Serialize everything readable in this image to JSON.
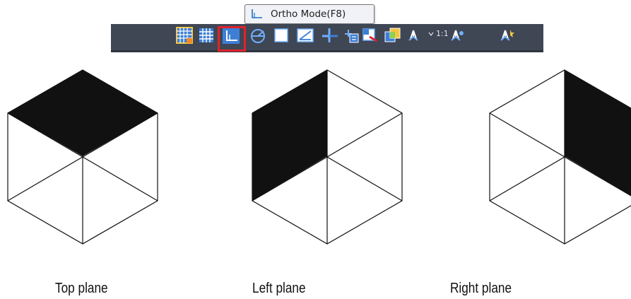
{
  "tooltip": {
    "text": "Ortho Mode(F8)",
    "icon": "ortho-icon"
  },
  "statusbar": {
    "scale_label": "1:1",
    "items": [
      "grid-display-icon",
      "snap-mode-icon",
      "ortho-mode-icon",
      "polar-tracking-icon",
      "isometric-draft-icon",
      "object-snap-tracking-icon",
      "dynamic-ucs-icon",
      "selection-cycling-icon",
      "show-gizmo-icon",
      "transparency-icon",
      "annotation-scale-icon",
      "annotation-visibility-icon",
      "auto-scale-icon"
    ],
    "active_highlight_color": "#e0232b"
  },
  "planes": [
    {
      "label": "Top plane",
      "filled": "top"
    },
    {
      "label": "Left plane",
      "filled": "left"
    },
    {
      "label": "Right plane",
      "filled": "right"
    }
  ]
}
